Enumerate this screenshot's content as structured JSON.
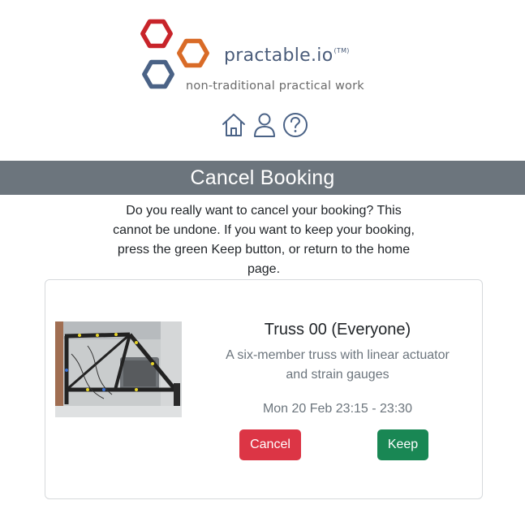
{
  "brand": {
    "name": "practable.io",
    "trademark": "(TM)",
    "tagline": "non-traditional practical work",
    "hex_colors": {
      "red": "#c8242a",
      "orange": "#d96b27",
      "blue": "#4a6286"
    }
  },
  "nav": {
    "home_icon": "home-icon",
    "user_icon": "user-icon",
    "help_icon": "help-icon"
  },
  "header": {
    "title": "Cancel Booking"
  },
  "message": "Do you really want to cancel your booking? This cannot be undone. If you want to keep your booking, press the green Keep button, or return to the home page.",
  "booking": {
    "experiment_name": "Truss 00 (Everyone)",
    "description": "A six-member truss with linear actuator and strain gauges",
    "time": "Mon 20 Feb 23:15 - 23:30",
    "cancel_label": "Cancel",
    "keep_label": "Keep"
  },
  "colors": {
    "header_bg": "#6c757d",
    "cancel": "#dc3545",
    "keep": "#198754"
  }
}
